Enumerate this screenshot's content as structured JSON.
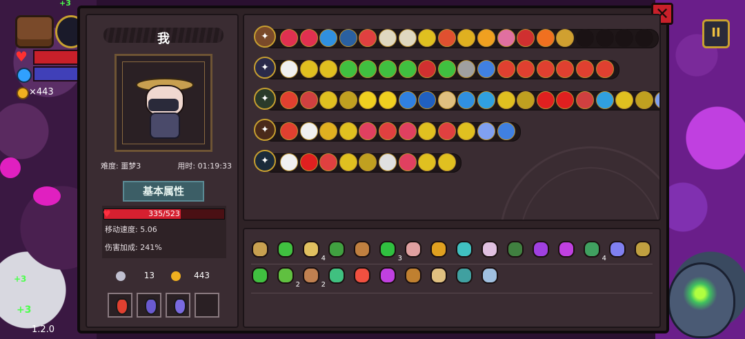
{
  "hud": {
    "gold": "×443",
    "plus_top": "+3",
    "plus_a": "+3",
    "plus_b": "+3",
    "version": "1.2.0",
    "pause_icon": "pause-icon"
  },
  "character": {
    "name": "我",
    "difficulty_label": "难度: 噩梦3",
    "time_label": "用时: 01:19:33",
    "tab_label": "基本属性",
    "hp_text": "335/523",
    "hp_current": 335,
    "hp_max": 523,
    "move_speed": "移动速度: 5.06",
    "damage_bonus": "伤害加成: 241%",
    "keys": "13",
    "coins": "443"
  },
  "potions": [
    {
      "name": "red-potion",
      "color": "#e04030"
    },
    {
      "name": "purple-potion",
      "color": "#6a5ad0"
    },
    {
      "name": "purple-potion",
      "color": "#7a6ae0"
    },
    {
      "name": "empty-slot",
      "color": ""
    }
  ],
  "weapon_rows": [
    {
      "weapon": "chest-relic-icon",
      "weapon_color": "#7a4a2a",
      "runes": [
        {
          "icon": "red-fang-rune",
          "c": "#e03050"
        },
        {
          "icon": "red-fang-rune",
          "c": "#e03050"
        },
        {
          "icon": "blue-spirit-rune",
          "c": "#3090e0"
        },
        {
          "icon": "blue-spirit-rune",
          "c": "#2a60a0"
        },
        {
          "icon": "red-swirl-rune",
          "c": "#e04040"
        },
        {
          "icon": "book-rune",
          "c": "#e0d8c0"
        },
        {
          "icon": "book-rune",
          "c": "#e0d8c0"
        },
        {
          "icon": "yellow-bolt-rune",
          "c": "#e0c020"
        },
        {
          "icon": "target-rune",
          "c": "#e05030"
        },
        {
          "icon": "yellow-claw-rune",
          "c": "#e0b020"
        },
        {
          "icon": "sun-rune",
          "c": "#f0a020"
        },
        {
          "icon": "pink-flower-rune",
          "c": "#e070a0"
        },
        {
          "icon": "red-worm-rune",
          "c": "#d03030"
        },
        {
          "icon": "fire-rune",
          "c": "#f07020"
        },
        {
          "icon": "wave-rune",
          "c": "#d0a030"
        },
        {
          "icon": "empty",
          "c": ""
        },
        {
          "icon": "empty",
          "c": ""
        },
        {
          "icon": "empty",
          "c": ""
        },
        {
          "icon": "empty",
          "c": ""
        }
      ]
    },
    {
      "weapon": "magic-wand-icon",
      "weapon_color": "#2a2a4a",
      "runes": [
        {
          "icon": "white-spirit-rune",
          "c": "#f0f0f0"
        },
        {
          "icon": "yellow-slash-rune",
          "c": "#e0c020"
        },
        {
          "icon": "yellow-slash-rune",
          "c": "#e0c020"
        },
        {
          "icon": "green-slash-rune",
          "c": "#40c040"
        },
        {
          "icon": "green-slime-rune",
          "c": "#40c040"
        },
        {
          "icon": "green-slime-rune",
          "c": "#40c040"
        },
        {
          "icon": "green-slime-rune",
          "c": "#40c040"
        },
        {
          "icon": "red-worm-rune",
          "c": "#d03030"
        },
        {
          "icon": "green-slime-rune",
          "c": "#40c040"
        },
        {
          "icon": "grey-claw-rune",
          "c": "#a0a0a0"
        },
        {
          "icon": "blue-cross-rune",
          "c": "#4080e0"
        },
        {
          "icon": "red-feather-rune",
          "c": "#e04030"
        },
        {
          "icon": "red-feather-rune",
          "c": "#e04030"
        },
        {
          "icon": "red-feather-rune",
          "c": "#e04030"
        },
        {
          "icon": "red-feather-rune",
          "c": "#e04030"
        },
        {
          "icon": "red-feather-rune",
          "c": "#e04030"
        },
        {
          "icon": "red-feather-rune",
          "c": "#e04030"
        }
      ]
    },
    {
      "weapon": "green-staff-icon",
      "weapon_color": "#2a3a2a",
      "runes": [
        {
          "icon": "red-gem-rune",
          "c": "#e04030"
        },
        {
          "icon": "red-gem-rune",
          "c": "#d04040"
        },
        {
          "icon": "gold-coin-rune",
          "c": "#e0c020"
        },
        {
          "icon": "gold-coin-rune",
          "c": "#c0a020"
        },
        {
          "icon": "yellow-gear-rune",
          "c": "#f0d020"
        },
        {
          "icon": "yellow-gear-rune",
          "c": "#f0d020"
        },
        {
          "icon": "blue-orb-rune",
          "c": "#3080e0"
        },
        {
          "icon": "blue-orb-rune",
          "c": "#2060c0"
        },
        {
          "icon": "bread-rune",
          "c": "#e0c080"
        },
        {
          "icon": "blue-spirit-rune",
          "c": "#3090e0"
        },
        {
          "icon": "blue-wave-rune",
          "c": "#30a0e0"
        },
        {
          "icon": "gold-coin-rune",
          "c": "#e0c020"
        },
        {
          "icon": "gold-coin-rune",
          "c": "#c0a020"
        },
        {
          "icon": "cherry-rune",
          "c": "#e02020"
        },
        {
          "icon": "cherry-rune",
          "c": "#e02020"
        },
        {
          "icon": "red-gem-rune",
          "c": "#d04040"
        },
        {
          "icon": "blue-wave-rune",
          "c": "#30a0e0"
        },
        {
          "icon": "gold-coin-rune",
          "c": "#e0c020"
        },
        {
          "icon": "gold-coin-rune",
          "c": "#c0a020"
        },
        {
          "icon": "blue-star-rune",
          "c": "#80a0f0"
        },
        {
          "icon": "purple-gem-rune",
          "c": "#e04080"
        }
      ]
    },
    {
      "weapon": "fire-staff-icon",
      "weapon_color": "#4a2a1a",
      "runes": [
        {
          "icon": "red-diamond-rune",
          "c": "#e04030"
        },
        {
          "icon": "white-spirit-rune",
          "c": "#f0f0f0"
        },
        {
          "icon": "yellow-claw-rune",
          "c": "#e0b020"
        },
        {
          "icon": "yellow-bolt-rune",
          "c": "#e0c020"
        },
        {
          "icon": "red-flower-rune",
          "c": "#e04060"
        },
        {
          "icon": "red-box-rune",
          "c": "#e04040"
        },
        {
          "icon": "red-flower-rune",
          "c": "#e04060"
        },
        {
          "icon": "yellow-bolt-rune",
          "c": "#e0c020"
        },
        {
          "icon": "red-box-rune",
          "c": "#e04040"
        },
        {
          "icon": "yellow-grid-rune",
          "c": "#e0c020"
        },
        {
          "icon": "blue-star-rune",
          "c": "#80a0f0"
        },
        {
          "icon": "blue-cross-rune",
          "c": "#4080e0"
        }
      ]
    },
    {
      "weapon": "blue-staff-icon",
      "weapon_color": "#1a2a3a",
      "runes": [
        {
          "icon": "white-spirit-rune",
          "c": "#f0f0f0"
        },
        {
          "icon": "cherry-rune",
          "c": "#e02020"
        },
        {
          "icon": "red-box-rune",
          "c": "#e04040"
        },
        {
          "icon": "gold-coin-rune",
          "c": "#e0c020"
        },
        {
          "icon": "gold-coin-rune",
          "c": "#c0a020"
        },
        {
          "icon": "eye-rune",
          "c": "#e0e0e0"
        },
        {
          "icon": "red-flower-rune",
          "c": "#e04060"
        },
        {
          "icon": "yellow-slash-rune",
          "c": "#e0c020"
        },
        {
          "icon": "yellow-slash-rune",
          "c": "#e0c020"
        }
      ]
    }
  ],
  "items": [
    {
      "icon": "straw-hat-icon",
      "c": "#c8a050",
      "count": ""
    },
    {
      "icon": "leaf-icon",
      "c": "#40c040",
      "count": ""
    },
    {
      "icon": "bell-icon",
      "c": "#e0c060",
      "count": "4"
    },
    {
      "icon": "green-pouch-icon",
      "c": "#40a040",
      "count": ""
    },
    {
      "icon": "lantern-icon",
      "c": "#c08040",
      "count": ""
    },
    {
      "icon": "clover-icon",
      "c": "#30c040",
      "count": "3"
    },
    {
      "icon": "bug-icon",
      "c": "#e0a0a0",
      "count": ""
    },
    {
      "icon": "pickaxe-icon",
      "c": "#e0a020",
      "count": ""
    },
    {
      "icon": "fish-icon",
      "c": "#40c0c0",
      "count": ""
    },
    {
      "icon": "feather-icon",
      "c": "#e0c0e0",
      "count": ""
    },
    {
      "icon": "scroll-icon",
      "c": "#408040",
      "count": ""
    },
    {
      "icon": "cape-icon",
      "c": "#a040e0",
      "count": ""
    },
    {
      "icon": "wand-icon",
      "c": "#c040e0",
      "count": ""
    },
    {
      "icon": "cloth-icon",
      "c": "#40a060",
      "count": "4"
    },
    {
      "icon": "crystal-icon",
      "c": "#8080f0",
      "count": ""
    },
    {
      "icon": "gear-charm-icon",
      "c": "#c0a040",
      "count": ""
    },
    {
      "icon": "turtle-icon",
      "c": "#40c040",
      "count": ""
    },
    {
      "icon": "green-bug-icon",
      "c": "#60c040",
      "count": "2"
    },
    {
      "icon": "bandage-icon",
      "c": "#c08050",
      "count": "2"
    },
    {
      "icon": "green-gem-icon",
      "c": "#40c080",
      "count": ""
    },
    {
      "icon": "heart-icon",
      "c": "#f05040",
      "count": ""
    },
    {
      "icon": "purple-eye-icon",
      "c": "#c040e0",
      "count": ""
    },
    {
      "icon": "chest-icon",
      "c": "#c08030",
      "count": ""
    },
    {
      "icon": "hourglass-icon",
      "c": "#e0c080",
      "count": ""
    },
    {
      "icon": "globe-icon",
      "c": "#40a0a0",
      "count": ""
    },
    {
      "icon": "key-icon",
      "c": "#a0c0e0",
      "count": ""
    }
  ]
}
